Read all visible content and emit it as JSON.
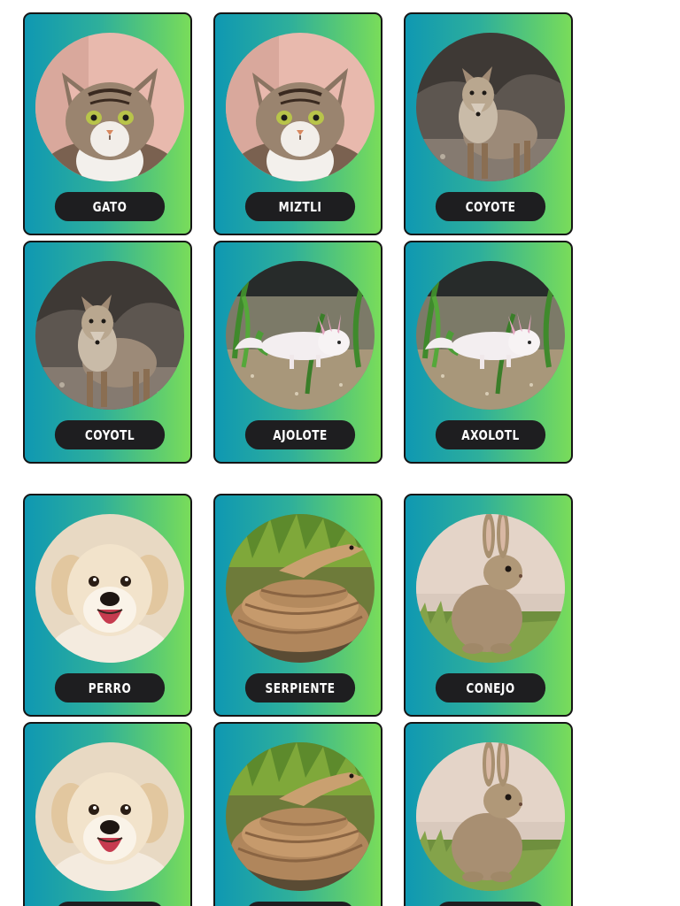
{
  "cards": [
    {
      "label": "GATO",
      "image": "cat-photo"
    },
    {
      "label": "MIZTLI",
      "image": "cat-photo"
    },
    {
      "label": "COYOTE",
      "image": "coyote-photo"
    },
    {
      "label": "COYOTL",
      "image": "coyote-photo"
    },
    {
      "label": "AJOLOTE",
      "image": "axolotl-photo"
    },
    {
      "label": "AXOLOTL",
      "image": "axolotl-photo"
    },
    {
      "label": "PERRO",
      "image": "puppy-photo"
    },
    {
      "label": "SERPIENTE",
      "image": "snake-photo"
    },
    {
      "label": "CONEJO",
      "image": "rabbit-photo"
    },
    {
      "label": "",
      "image": "puppy-photo"
    },
    {
      "label": "",
      "image": "snake-photo"
    },
    {
      "label": "",
      "image": "rabbit-photo"
    }
  ],
  "colors": {
    "card_gradient_start": "#0f98b2",
    "card_gradient_end": "#79dc5a",
    "label_bg": "#1e1e20",
    "label_text": "#ffffff"
  }
}
